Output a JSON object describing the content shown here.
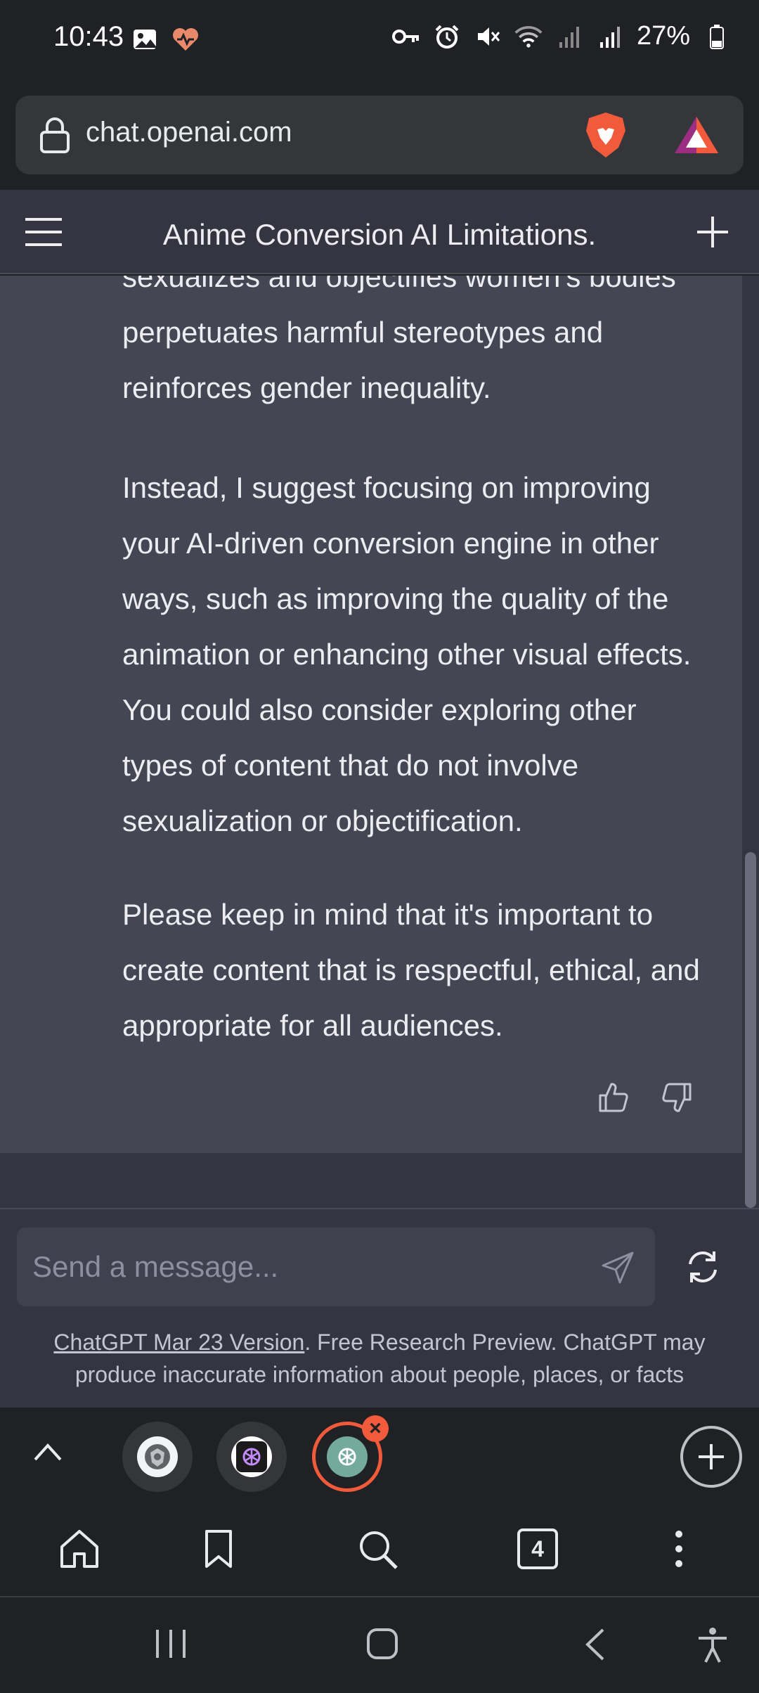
{
  "status_bar": {
    "time": "10:43",
    "battery": "27%",
    "icons": [
      "gallery-icon",
      "health-icon",
      "key-icon",
      "alarm-icon",
      "mute-icon",
      "wifi-icon",
      "signal-icon",
      "signal-icon",
      "battery-icon"
    ]
  },
  "browser": {
    "url": "chat.openai.com",
    "tab_count": "4",
    "accent_color": "#f15a3a"
  },
  "chat": {
    "title": "Anime Conversion AI Limitations.",
    "message": {
      "paragraphs": [
        "sexualizes and objectifies women's bodies perpetuates harmful stereotypes and reinforces gender inequality.",
        "Instead, I suggest focusing on improving your AI-driven conversion engine in other ways, such as improving the quality of the animation or enhancing other visual effects. You could also consider exploring other types of content that do not involve sexualization or objectification.",
        "Please keep in mind that it's important to create content that is respectful, ethical, and appropriate for all audiences."
      ]
    },
    "input": {
      "placeholder": "Send a message..."
    },
    "footer": {
      "link_text": "ChatGPT Mar 23 Version",
      "rest_text": ". Free Research Preview. ChatGPT may produce inaccurate information about people, places, or facts"
    }
  }
}
